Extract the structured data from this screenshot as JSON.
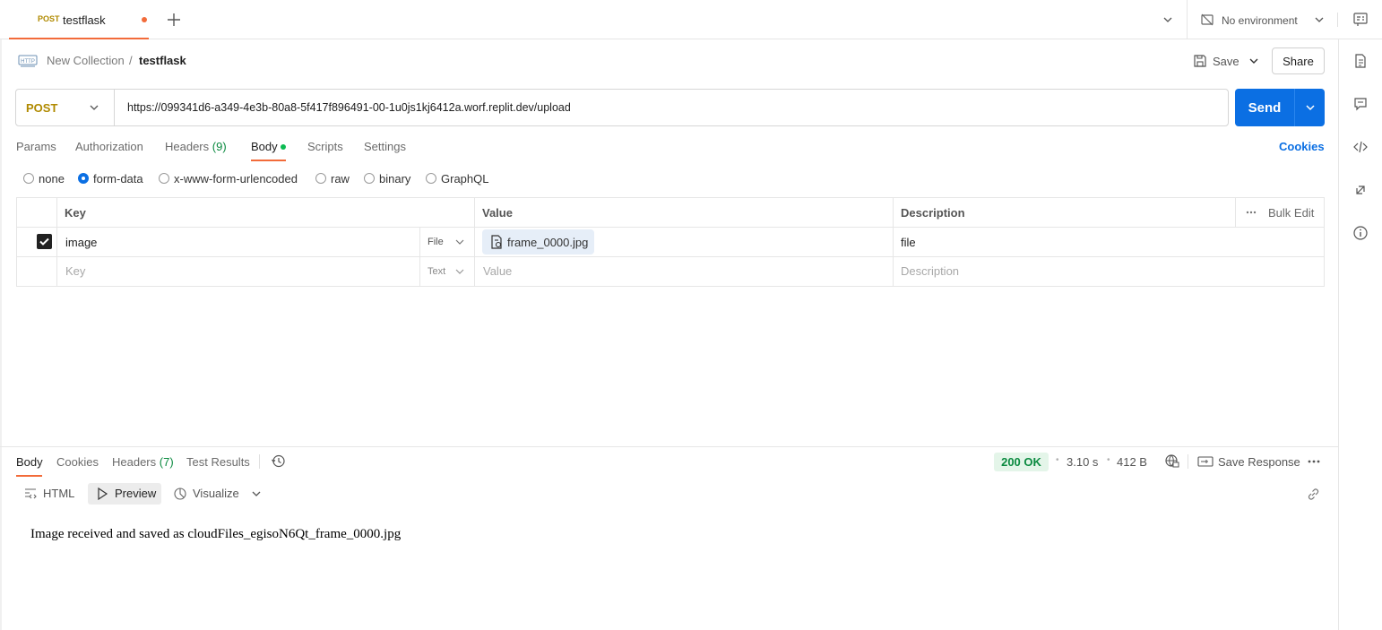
{
  "tabs": {
    "active": {
      "method": "POST",
      "name": "testflask"
    }
  },
  "environment": {
    "label": "No environment"
  },
  "breadcrumb": {
    "collection": "New Collection",
    "separator": "/",
    "request": "testflask"
  },
  "toolbar": {
    "save_label": "Save",
    "share_label": "Share"
  },
  "request": {
    "method": "POST",
    "url": "https://099341d6-a349-4e3b-80a8-5f417f896491-00-1u0js1kj6412a.worf.replit.dev/upload",
    "send_label": "Send"
  },
  "request_tabs": {
    "params": "Params",
    "authorization": "Authorization",
    "headers": "Headers",
    "headers_count": "(9)",
    "body": "Body",
    "scripts": "Scripts",
    "settings": "Settings",
    "cookies": "Cookies"
  },
  "body_types": {
    "none": "none",
    "form_data": "form-data",
    "urlencoded": "x-www-form-urlencoded",
    "raw": "raw",
    "binary": "binary",
    "graphql": "GraphQL",
    "selected": "form-data"
  },
  "table": {
    "headers": {
      "key": "Key",
      "value": "Value",
      "description": "Description",
      "bulk_edit": "Bulk Edit"
    },
    "rows": [
      {
        "key": "image",
        "type": "File",
        "value": "frame_0000.jpg",
        "description": "file",
        "checked": true
      }
    ],
    "placeholder": {
      "key": "Key",
      "type": "Text",
      "value": "Value",
      "description": "Description"
    }
  },
  "response": {
    "tabs": {
      "body": "Body",
      "cookies": "Cookies",
      "headers": "Headers",
      "headers_count": "(7)",
      "test_results": "Test Results"
    },
    "status": "200 OK",
    "time": "3.10 s",
    "size": "412 B",
    "save_response": "Save Response",
    "views": {
      "html": "HTML",
      "preview": "Preview",
      "visualize": "Visualize"
    },
    "body_text": "Image received and saved as cloudFiles_egisoN6Qt_frame_0000.jpg"
  },
  "colors": {
    "accent": "#f26b3a",
    "primary": "#0b6fe3",
    "method_post": "#b08a00",
    "success": "#0b8a40"
  }
}
